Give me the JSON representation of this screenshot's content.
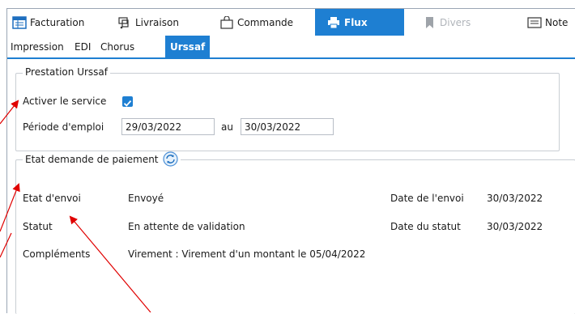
{
  "tabs": [
    {
      "label": "Facturation",
      "icon": "invoice-icon"
    },
    {
      "label": "Livraison",
      "icon": "delivery-icon"
    },
    {
      "label": "Commande",
      "icon": "shopping-bag-icon"
    },
    {
      "label": "Flux",
      "icon": "printer-icon",
      "active": true
    },
    {
      "label": "Divers",
      "icon": "bookmark-icon",
      "disabled": true
    },
    {
      "label": "Note",
      "icon": "note-icon"
    }
  ],
  "subtabs": [
    {
      "label": "Impression"
    },
    {
      "label": "EDI"
    },
    {
      "label": "Chorus"
    },
    {
      "label": "Urssaf",
      "active": true
    }
  ],
  "prestation": {
    "title": "Prestation Urssaf",
    "activer_label": "Activer le service",
    "activer_checked": true,
    "periode_label": "Période d'emploi",
    "date_from": "29/03/2022",
    "au_label": "au",
    "date_to": "30/03/2022"
  },
  "etat": {
    "title": "Etat demande de paiement",
    "refresh_icon": "refresh-icon",
    "envoi_label": "Etat d'envoi",
    "envoi_value": "Envoyé",
    "date_envoi_label": "Date de l'envoi",
    "date_envoi_value": "30/03/2022",
    "statut_label": "Statut",
    "statut_value": "En attente de validation",
    "date_statut_label": "Date du statut",
    "date_statut_value": "30/03/2022",
    "complements_label": "Compléments",
    "complements_value": "Virement : Virement d'un montant  le 05/04/2022"
  },
  "colors": {
    "accent": "#1e7fd2",
    "annotation": "#e00000"
  }
}
